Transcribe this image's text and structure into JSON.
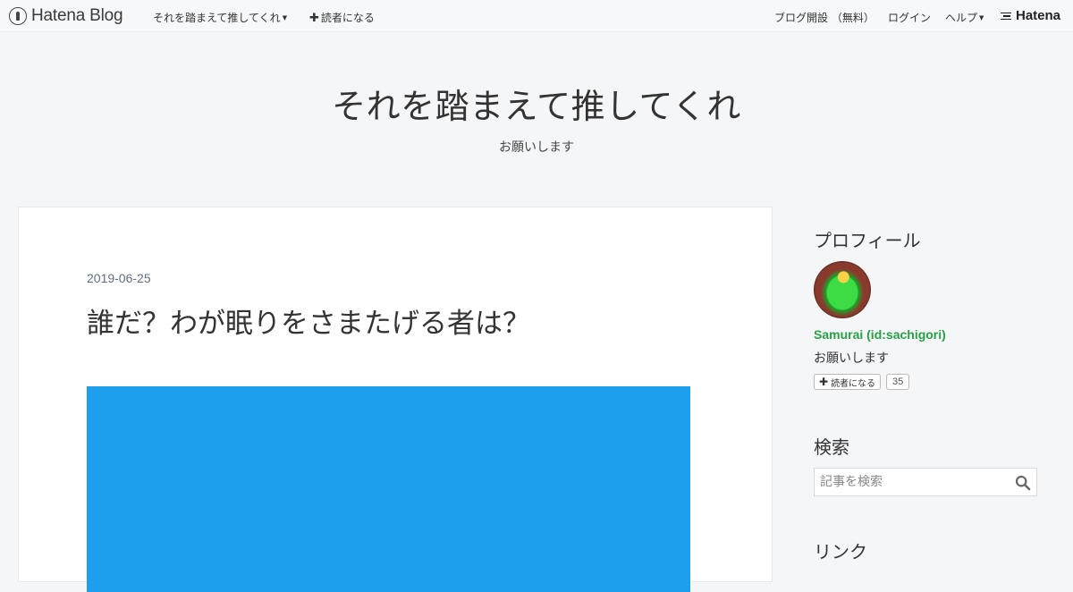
{
  "globalbar": {
    "brand_name": "Hatena Blog",
    "blog_menu_label": "それを踏まえて推してくれ",
    "subscribe_label": "読者になる",
    "open_blog_label": "ブログ開設 （無料）",
    "login_label": "ログイン",
    "help_label": "ヘルプ",
    "corp_logo_text": "Hatena"
  },
  "blog": {
    "title": "それを踏まえて推してくれ",
    "description": "お願いします"
  },
  "entry": {
    "date": "2019-06-25",
    "title": "誰だ？わが眠りをさまたげる者は？",
    "embed_color": "#1e9fee"
  },
  "sidebar": {
    "profile": {
      "heading": "プロフィール",
      "name": "Samurai (id:sachigori)",
      "description": "お願いします",
      "subscribe_label": "読者になる",
      "subscriber_count": "35"
    },
    "search": {
      "heading": "検索",
      "placeholder": "記事を検索"
    },
    "links": {
      "heading": "リンク"
    }
  },
  "colors": {
    "background": "#f5f6f8",
    "profile_name": "#27a046",
    "date_text": "#5f6f7f"
  },
  "icons": [
    "hatena-blog-logo-icon",
    "caret-down-icon",
    "plus-icon",
    "hatena-logo-icon",
    "search-icon"
  ]
}
